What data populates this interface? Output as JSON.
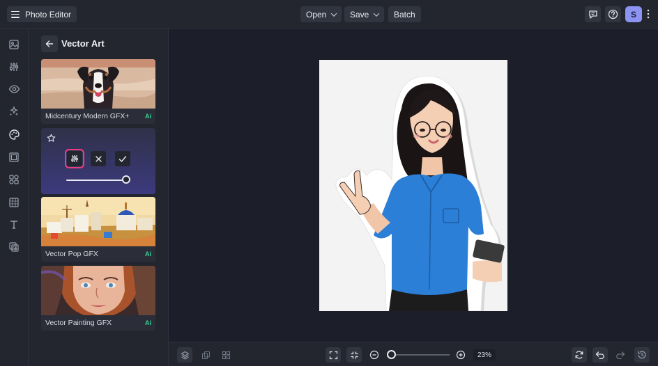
{
  "app": {
    "title": "Photo Editor"
  },
  "toolbar": {
    "open_label": "Open",
    "save_label": "Save",
    "batch_label": "Batch",
    "user_initial": "S"
  },
  "panel": {
    "title": "Vector Art",
    "cards": [
      {
        "label": "Midcentury Modern GFX+",
        "badge": "Ai"
      },
      {
        "label": "Vector Pop GFX",
        "badge": "Ai"
      },
      {
        "label": "Vector Painting GFX",
        "badge": "Ai"
      }
    ],
    "active_card": {
      "intensity": 1.0
    }
  },
  "rail": {
    "icons": [
      "image-icon",
      "adjustments-icon",
      "eye-icon",
      "effects-sparkle-icon",
      "artsy-palette-icon",
      "frames-icon",
      "graphics-icon",
      "overlay-icon",
      "text-icon",
      "texture-icon"
    ]
  },
  "bottom": {
    "zoom_value": "23%",
    "zoom_level": 0.23
  },
  "colors": {
    "background": "#1c1f29",
    "panel": "#23262f",
    "accent_pink": "#ec3e7c",
    "ai_green": "#3ad39a",
    "avatar": "#8c93f0"
  }
}
